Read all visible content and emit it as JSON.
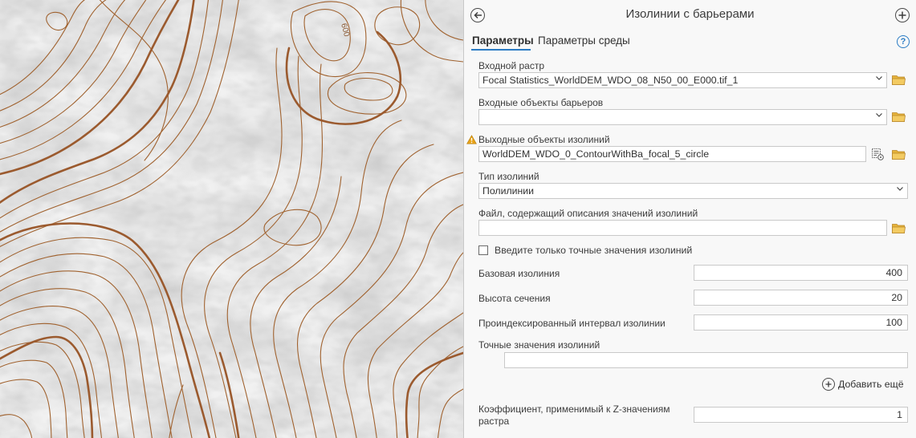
{
  "map": {
    "contour_label": "600"
  },
  "panel": {
    "title": "Изолинии с барьерами",
    "tabs": [
      {
        "label": "Параметры",
        "active": true
      },
      {
        "label": "Параметры среды",
        "active": false
      }
    ],
    "fields": {
      "input_raster": {
        "label": "Входной растр",
        "value": "Focal Statistics_WorldDEM_WDO_08_N50_00_E000.tif_1"
      },
      "barrier_features": {
        "label": "Входные объекты барьеров",
        "value": ""
      },
      "output_contours": {
        "label": "Выходные объекты изолиний",
        "value": "WorldDEM_WDO_0_ContourWithBa_focal_5_circle",
        "warning": true
      },
      "contour_type": {
        "label": "Тип изолиний",
        "value": "Полилинии"
      },
      "values_file": {
        "label": "Файл, содержащий описания значений изолиний",
        "value": ""
      },
      "explicit_only": {
        "label": "Введите только точные значения изолиний",
        "checked": false
      },
      "base_contour": {
        "label": "Базовая изолиния",
        "value": "400"
      },
      "interval": {
        "label": "Высота сечения",
        "value": "20"
      },
      "indexed_interval": {
        "label": "Проиндексированный интервал изолинии",
        "value": "100"
      },
      "explicit_values": {
        "label": "Точные значения изолиний",
        "value": ""
      },
      "add_another": {
        "label": "Добавить ещё"
      },
      "z_factor": {
        "label_line1": "Коэффициент, применимый к Z-значениям",
        "label_line2": "растра",
        "value": "1"
      }
    },
    "colors": {
      "accent": "#2a7bc4",
      "warning": "#e8a317",
      "folder": "#e6b33a",
      "contour": "#9b5a2e"
    },
    "icons": [
      "back-arrow-icon",
      "add-icon",
      "help-icon",
      "chevron-down-icon",
      "folder-icon",
      "warning-icon",
      "dataset-properties-icon",
      "plus-circle-icon"
    ]
  }
}
